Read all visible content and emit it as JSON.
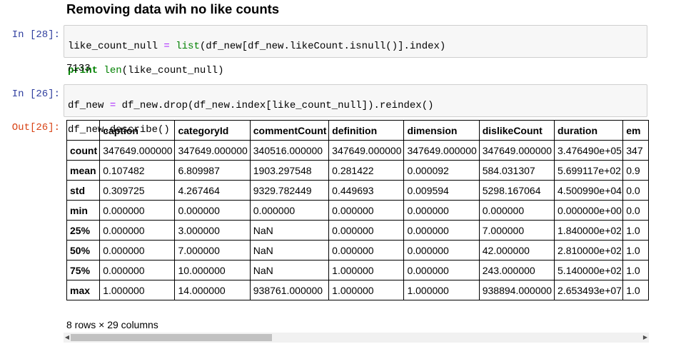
{
  "markdown": {
    "heading": "Removing data wih no like counts"
  },
  "cells": [
    {
      "prompt": "In [28]:",
      "code_lines": [
        "like_count_null = list(df_new[df_new.likeCount.isnull()].index)",
        "print len(like_count_null)"
      ],
      "output": "7133"
    },
    {
      "prompt": "In [26]:",
      "code_lines": [
        "df_new = df_new.drop(df_new.index[like_count_null]).reindex()",
        "df_new.describe()"
      ],
      "out_prompt": "Out[26]:"
    }
  ],
  "dataframe": {
    "columns": [
      "caption",
      "categoryId",
      "commentCount",
      "definition",
      "dimension",
      "dislikeCount",
      "duration",
      "em"
    ],
    "rows": [
      {
        "label": "count",
        "values": [
          "347649.000000",
          "347649.000000",
          "340516.000000",
          "347649.000000",
          "347649.000000",
          "347649.000000",
          "3.476490e+05",
          "347"
        ]
      },
      {
        "label": "mean",
        "values": [
          "0.107482",
          "6.809987",
          "1903.297548",
          "0.281422",
          "0.000092",
          "584.031307",
          "5.699117e+02",
          "0.9"
        ]
      },
      {
        "label": "std",
        "values": [
          "0.309725",
          "4.267464",
          "9329.782449",
          "0.449693",
          "0.009594",
          "5298.167064",
          "4.500990e+04",
          "0.0"
        ]
      },
      {
        "label": "min",
        "values": [
          "0.000000",
          "0.000000",
          "0.000000",
          "0.000000",
          "0.000000",
          "0.000000",
          "0.000000e+00",
          "0.0"
        ]
      },
      {
        "label": "25%",
        "values": [
          "0.000000",
          "3.000000",
          "NaN",
          "0.000000",
          "0.000000",
          "7.000000",
          "1.840000e+02",
          "1.0"
        ]
      },
      {
        "label": "50%",
        "values": [
          "0.000000",
          "7.000000",
          "NaN",
          "0.000000",
          "0.000000",
          "42.000000",
          "2.810000e+02",
          "1.0"
        ]
      },
      {
        "label": "75%",
        "values": [
          "0.000000",
          "10.000000",
          "NaN",
          "1.000000",
          "0.000000",
          "243.000000",
          "5.140000e+02",
          "1.0"
        ]
      },
      {
        "label": "max",
        "values": [
          "1.000000",
          "14.000000",
          "938761.000000",
          "1.000000",
          "1.000000",
          "938894.000000",
          "2.653493e+07",
          "1.0"
        ]
      }
    ],
    "shape_text": "8 rows × 29 columns"
  },
  "scrollbar": {
    "left_arrow_icon": "◀",
    "right_arrow_icon": "▶"
  }
}
